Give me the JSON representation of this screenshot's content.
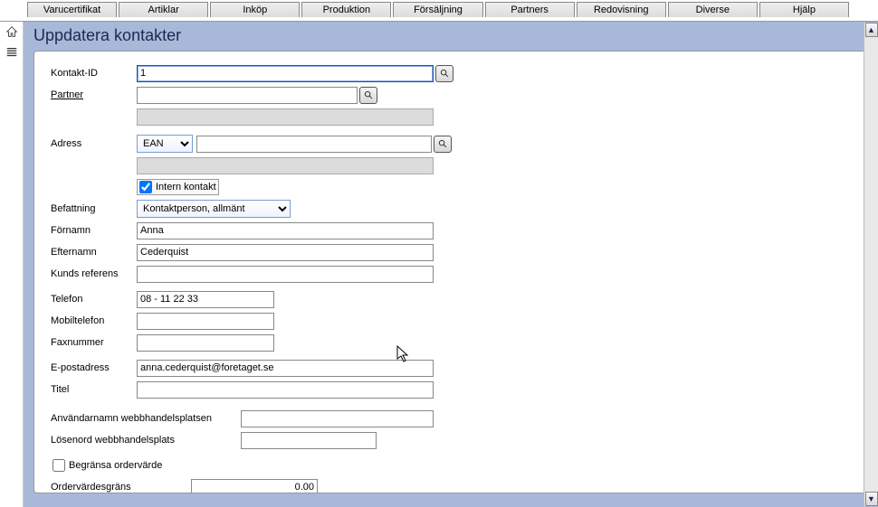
{
  "menu": [
    "Varucertifikat",
    "Artiklar",
    "Inköp",
    "Produktion",
    "Försäljning",
    "Partners",
    "Redovisning",
    "Diverse",
    "Hjälp"
  ],
  "page_title": "Uppdatera kontakter",
  "labels": {
    "kontakt_id": "Kontakt-ID",
    "partner": "Partner",
    "adress": "Adress",
    "intern_kontakt": "Intern kontakt",
    "befattning": "Befattning",
    "fornamn": "Förnamn",
    "efternamn": "Efternamn",
    "kunds_referens": "Kunds referens",
    "telefon": "Telefon",
    "mobiltelefon": "Mobiltelefon",
    "faxnummer": "Faxnummer",
    "epost": "E-postadress",
    "titel": "Titel",
    "webuser": "Användarnamn webbhandelsplatsen",
    "webpass": "Lösenord webbhandelsplats",
    "begransa": "Begränsa ordervärde",
    "ordergrans": "Ordervärdesgräns"
  },
  "values": {
    "kontakt_id": "1",
    "partner": "",
    "adress_type": "EAN",
    "adress_val": "",
    "intern_kontakt_checked": true,
    "befattning": "Kontaktperson, allmänt",
    "fornamn": "Anna",
    "efternamn": "Cederquist",
    "kunds_referens": "",
    "telefon": "08 - 11 22 33",
    "mobiltelefon": "",
    "faxnummer": "",
    "epost": "anna.cederquist@foretaget.se",
    "titel": "",
    "webuser": "",
    "webpass": "",
    "begransa_checked": false,
    "ordergrans": "0.00"
  }
}
